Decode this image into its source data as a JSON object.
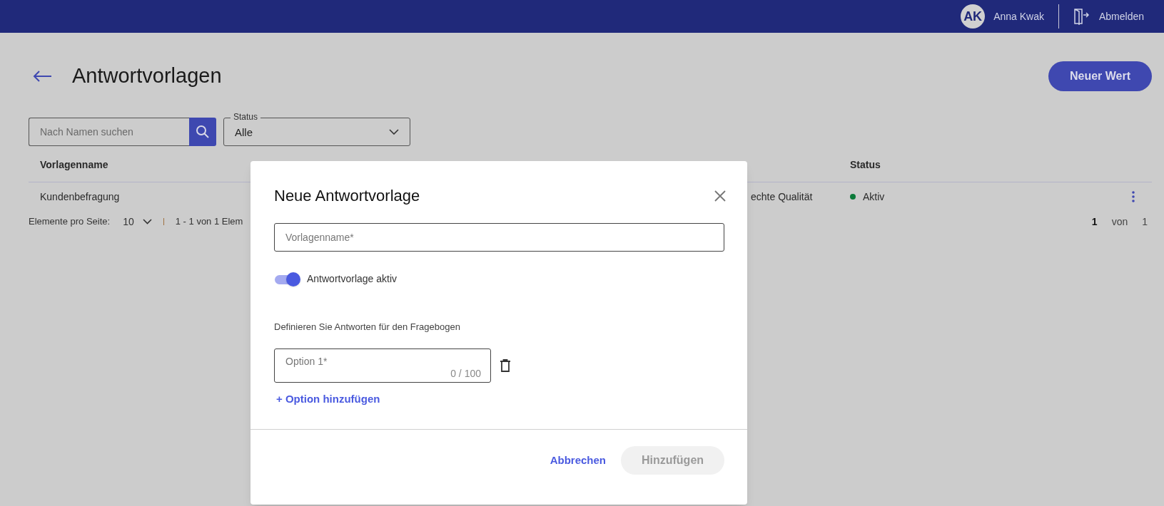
{
  "header": {
    "user": {
      "initials": "AK",
      "name": "Anna Kwak"
    },
    "logout": "Abmelden"
  },
  "page": {
    "title": "Antwortvorlagen",
    "new_button": "Neuer Wert"
  },
  "filters": {
    "search": {
      "placeholder": "Nach Namen suchen"
    },
    "status": {
      "label": "Status",
      "value": "Alle"
    }
  },
  "table": {
    "columns": [
      {
        "label": "Vorlagenname"
      },
      {
        "label": "Status"
      }
    ],
    "rows": [
      {
        "name": "Kundenbefragung",
        "column_2": "echte Qualität",
        "status": {
          "label": "Aktiv",
          "color": "#0c7a3a"
        }
      }
    ]
  },
  "pagination": {
    "per_page_label": "Elemente pro Seite:",
    "per_page_value": "10",
    "range": "1 - 1 von 1 Elem",
    "page": "1",
    "of": "von",
    "total": "1"
  },
  "dialog": {
    "title": "Neue Antwortvorlage",
    "name_field": {
      "placeholder": "Vorlagenname*"
    },
    "toggle": {
      "label": "Antwortvorlage aktiv",
      "on": true
    },
    "description": "Definieren Sie Antworten für den Fragebogen",
    "options": [
      {
        "placeholder": "Option 1*",
        "counter": "0 / 100"
      }
    ],
    "add_option": "+ Option hinzufügen",
    "cancel": "Abbrechen",
    "submit": {
      "label": "Hinzufügen",
      "disabled": true
    }
  }
}
